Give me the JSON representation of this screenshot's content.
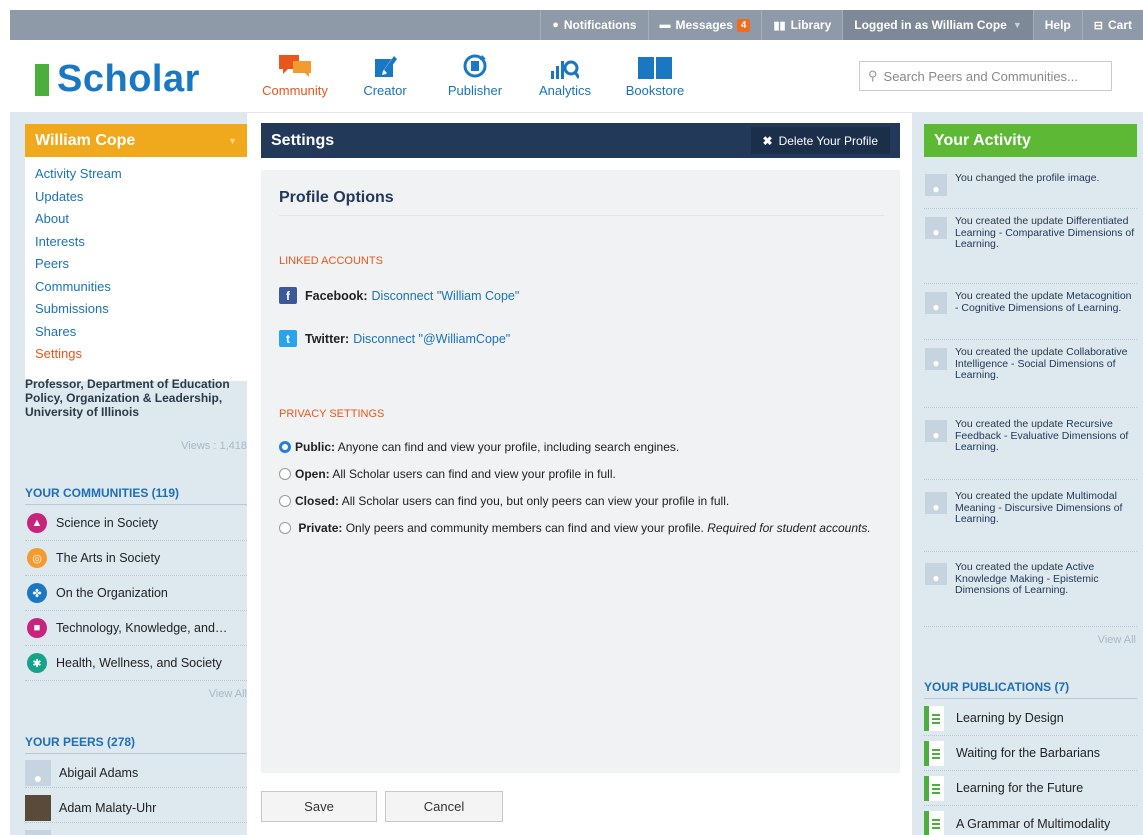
{
  "topbar": {
    "notifications": "Notifications",
    "messages": "Messages",
    "messages_count": "4",
    "library": "Library",
    "login": "Logged in as William Cope",
    "help": "Help",
    "cart": "Cart"
  },
  "header": {
    "logo": "Scholar",
    "nav": [
      {
        "label": "Community",
        "icon": "chat-bubbles-icon"
      },
      {
        "label": "Creator",
        "icon": "pencil-icon"
      },
      {
        "label": "Publisher",
        "icon": "publish-cycle-icon"
      },
      {
        "label": "Analytics",
        "icon": "analytics-icon"
      },
      {
        "label": "Bookstore",
        "icon": "book-icon"
      }
    ],
    "search_placeholder": "Search Peers and Communities..."
  },
  "left": {
    "user_name": "William Cope",
    "menu": [
      "Activity Stream",
      "Updates",
      "About",
      "Interests",
      "Peers",
      "Communities",
      "Submissions",
      "Shares",
      "Settings"
    ],
    "selected": "Settings",
    "bio": "Professor, Department of Education Policy, Organization & Leadership, University of Illinois",
    "views": "Views : 1,418",
    "communities_title": "YOUR COMMUNITIES (119)",
    "communities": [
      {
        "name": "Science in Society",
        "color": "#c8237d"
      },
      {
        "name": "The Arts in Society",
        "color": "#f39b2f"
      },
      {
        "name": "On the Organization",
        "color": "#1a78c2"
      },
      {
        "name": "Technology, Knowledge, and…",
        "color": "#c8237d"
      },
      {
        "name": "Health, Wellness, and Society",
        "color": "#17a389"
      }
    ],
    "view_all": "View All",
    "peers_title": "YOUR PEERS (278)",
    "peers": [
      "Abigail Adams",
      "Adam Malaty-Uhr"
    ]
  },
  "main": {
    "title": "Settings",
    "delete_label": "Delete Your Profile",
    "profile_options": "Profile Options",
    "linked_accounts": "LINKED ACCOUNTS",
    "facebook_label": "Facebook:",
    "facebook_link": "Disconnect \"William Cope\"",
    "twitter_label": "Twitter:",
    "twitter_link": "Disconnect \"@WilliamCope\"",
    "privacy_settings": "PRIVACY SETTINGS",
    "privacy": [
      {
        "label": "Public:",
        "text": "Anyone can find and view your profile, including search engines.",
        "note": "",
        "selected": true
      },
      {
        "label": "Open:",
        "text": "All Scholar users can find and view your profile in full.",
        "note": "",
        "selected": false
      },
      {
        "label": "Closed:",
        "text": "All Scholar users can find you, but only peers can view your profile in full.",
        "note": "",
        "selected": false
      },
      {
        "label": "Private:",
        "text": "Only peers and community members can find and view your profile.",
        "note": "Required for student accounts.",
        "selected": false
      }
    ],
    "save": "Save",
    "cancel": "Cancel"
  },
  "right": {
    "activity_title": "Your Activity",
    "activities": [
      {
        "prefix": "You changed the",
        "link": "profile image."
      },
      {
        "prefix": "You created the update",
        "link": "Differentiated Learning - Comparative Dimensions of Learning."
      },
      {
        "prefix": "You created the update",
        "link": "Metacognition - Cognitive Dimensions of Learning."
      },
      {
        "prefix": "You created the update",
        "link": "Collaborative Intelligence - Social Dimensions of Learning."
      },
      {
        "prefix": "You created the update",
        "link": "Recursive Feedback - Evaluative Dimensions of Learning."
      },
      {
        "prefix": "You created the update",
        "link": "Multimodal Meaning - Discursive Dimensions of Learning."
      },
      {
        "prefix": "You created the update",
        "link": "Active Knowledge Making - Epistemic Dimensions of Learning."
      }
    ],
    "view_all": "View All",
    "publications_title": "YOUR PUBLICATIONS (7)",
    "publications": [
      "Learning by Design",
      "Waiting for the Barbarians",
      "Learning for the Future",
      "A Grammar of Multimodality"
    ]
  },
  "colors": {
    "brand_blue": "#1a78c2",
    "brand_green": "#4caf3d",
    "orange": "#e8561b",
    "user_head": "#f0a81d",
    "activity_head": "#5db836",
    "settings_head": "#22395a"
  }
}
